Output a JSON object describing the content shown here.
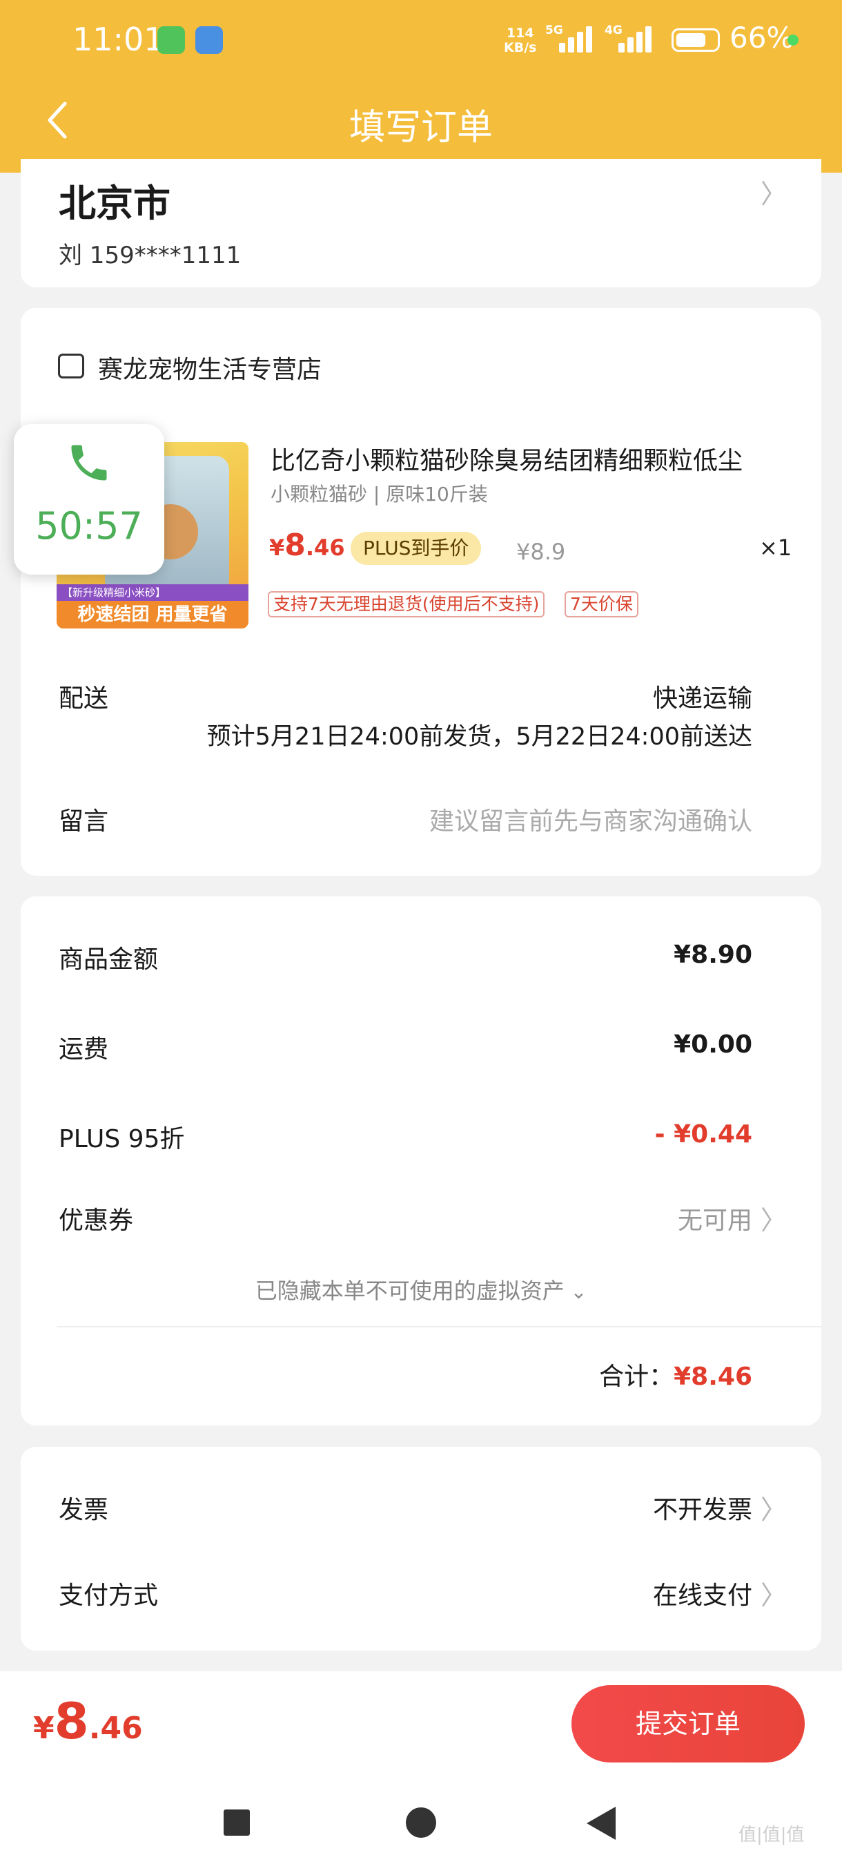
{
  "status_bar": {
    "time": "11:01",
    "net_speed_top": "114",
    "net_speed_unit": "KB/s",
    "sim1": "5G",
    "sim2": "4G",
    "battery": "66%"
  },
  "header": {
    "title": "填写订单"
  },
  "address": {
    "city": "北京市",
    "contact": "刘  159****1111"
  },
  "shop": {
    "name": "赛龙宠物生活专营店",
    "product": {
      "title": "比亿奇小颗粒猫砂除臭易结团精细颗粒低尘",
      "spec": "小颗粒猫砂 | 原味10斤装",
      "price_symbol": "¥",
      "price_int": "8",
      "price_dec": ".46",
      "plus_tag": "PLUS到手价",
      "original_price": "¥8.9",
      "qty": "×1",
      "service_tags": [
        "支持7天无理由退货(使用后不支持)",
        "7天价保"
      ],
      "image_text_top": "【新升级精细小米砂】",
      "image_text_bottom": "秒速结团 用量更省"
    },
    "delivery": {
      "label": "配送",
      "method": "快递运输",
      "estimate": "预计5月21日24:00前发货，5月22日24:00前送达"
    },
    "message": {
      "label": "留言",
      "placeholder": "建议留言前先与商家沟通确认"
    }
  },
  "fees": {
    "goods_label": "商品金额",
    "goods_value": "¥8.90",
    "shipping_label": "运费",
    "shipping_value": "¥0.00",
    "plus_label": "PLUS 95折",
    "plus_value": "- ¥0.44",
    "coupon_label": "优惠券",
    "coupon_value": "无可用",
    "hidden_note": "已隐藏本单不可使用的虚拟资产",
    "total_label": "合计：",
    "total_value": "¥8.46"
  },
  "invoice": {
    "invoice_label": "发票",
    "invoice_value": "不开发票",
    "pay_label": "支付方式",
    "pay_value": "在线支付"
  },
  "footer": {
    "price_symbol": "¥",
    "price_int": "8",
    "price_dec": ".46",
    "submit_label": "提交订单"
  },
  "call_overlay": {
    "timer": "50:57"
  },
  "watermark": "值|值|值",
  "colors": {
    "brand_yellow": "#f5bd3c",
    "price_red": "#e23c2c",
    "call_green": "#4cae56"
  }
}
